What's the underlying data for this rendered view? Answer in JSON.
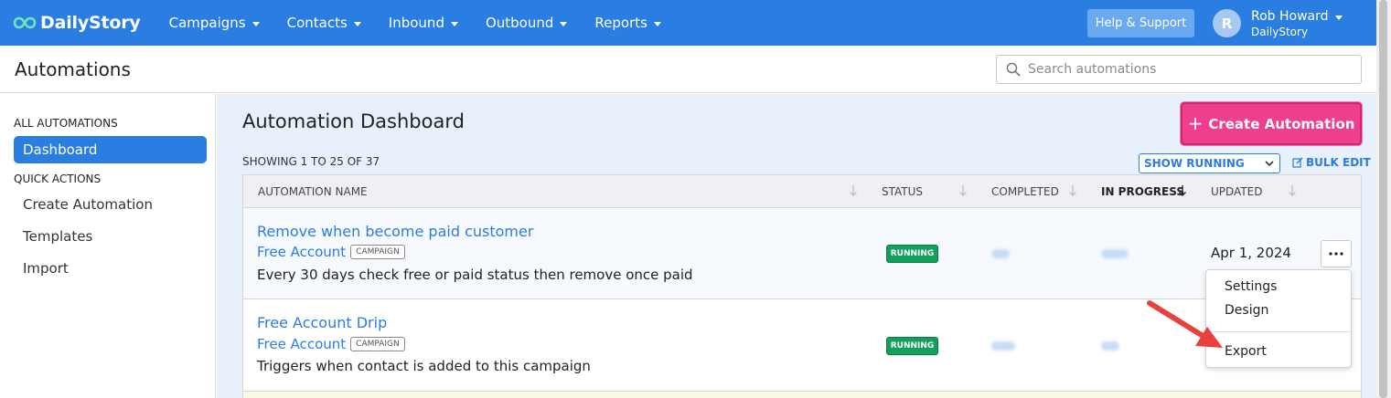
{
  "navbar": {
    "logo_text": "DailyStory",
    "menu": [
      "Campaigns",
      "Contacts",
      "Inbound",
      "Outbound",
      "Reports"
    ],
    "help_label": "Help & Support",
    "avatar_initial": "R",
    "user_name": "Rob Howard",
    "user_org": "DailyStory",
    "brand_color": "#2a7de1"
  },
  "header": {
    "title": "Automations",
    "search_placeholder": "Search automations"
  },
  "sidebar": {
    "section_all": "ALL AUTOMATIONS",
    "active_item": "Dashboard",
    "section_quick": "QUICK ACTIONS",
    "items": [
      "Create Automation",
      "Templates",
      "Import"
    ]
  },
  "main": {
    "title": "Automation Dashboard",
    "create_button": "Create Automation",
    "showing_text": "SHOWING 1 TO 25 OF 37",
    "filter_selected": "SHOW RUNNING",
    "bulk_edit": "BULK EDIT",
    "accent_color": "#ee3f8e"
  },
  "table": {
    "columns": [
      "AUTOMATION NAME",
      "STATUS",
      "COMPLETED",
      "IN PROGRESS",
      "UPDATED"
    ],
    "rows": [
      {
        "name": "Remove when become paid customer",
        "campaign": "Free Account",
        "tag": "CAMPAIGN",
        "description": "Every 30 days check free or paid status then remove once paid",
        "status": "RUNNING",
        "updated": "Apr 1, 2024"
      },
      {
        "name": "Free Account Drip",
        "campaign": "Free Account",
        "tag": "CAMPAIGN",
        "description": "Triggers when contact is added to this campaign",
        "status": "RUNNING",
        "updated": ""
      }
    ]
  },
  "dropdown": {
    "items": [
      "Settings",
      "Design",
      "Export"
    ]
  }
}
